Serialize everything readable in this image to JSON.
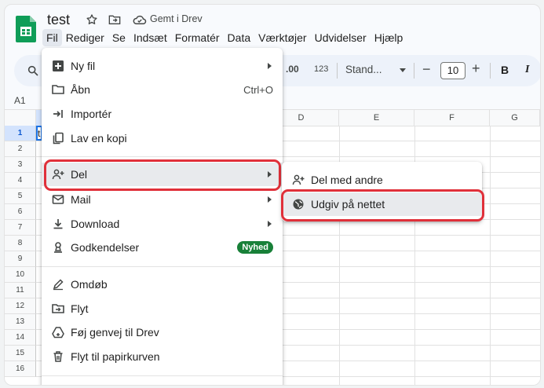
{
  "header": {
    "doc_title": "test",
    "saved_status": "Gemt i Drev"
  },
  "menubar": [
    "Fil",
    "Rediger",
    "Se",
    "Indsæt",
    "Formatér",
    "Data",
    "Værktøjer",
    "Udvidelser",
    "Hjælp"
  ],
  "toolbar": {
    "decimal_label": ".00",
    "format_label": "123",
    "font_label": "Stand...",
    "font_size": "10",
    "minus": "−",
    "plus": "+",
    "bold": "B",
    "italic": "I"
  },
  "namebox": "A1",
  "grid": {
    "columns": [
      "D",
      "E",
      "F",
      "G"
    ],
    "rows": [
      "1",
      "2",
      "3",
      "4",
      "5",
      "6",
      "7",
      "8",
      "9",
      "10",
      "11",
      "12",
      "13",
      "14",
      "15",
      "16"
    ],
    "cell_a1": "t"
  },
  "file_menu": {
    "items": [
      {
        "label": "Ny fil",
        "icon": "new-sheet-icon",
        "submenu": true
      },
      {
        "label": "Åbn",
        "icon": "folder-icon",
        "shortcut": "Ctrl+O"
      },
      {
        "label": "Importér",
        "icon": "import-icon"
      },
      {
        "label": "Lav en kopi",
        "icon": "copy-icon"
      },
      {
        "label": "Del",
        "icon": "share-person-icon",
        "submenu": true
      },
      {
        "label": "Mail",
        "icon": "mail-icon",
        "submenu": true
      },
      {
        "label": "Download",
        "icon": "download-icon",
        "submenu": true
      },
      {
        "label": "Godkendelser",
        "icon": "approvals-icon",
        "badge": "Nyhed"
      },
      {
        "label": "Omdøb",
        "icon": "rename-icon"
      },
      {
        "label": "Flyt",
        "icon": "move-folder-icon"
      },
      {
        "label": "Føj genvej til Drev",
        "icon": "drive-shortcut-icon"
      },
      {
        "label": "Flyt til papirkurven",
        "icon": "trash-icon"
      }
    ]
  },
  "share_menu": {
    "items": [
      {
        "label": "Del med andre",
        "icon": "share-person-icon"
      },
      {
        "label": "Udgiv på nettet",
        "icon": "globe-icon"
      }
    ]
  },
  "colors": {
    "highlight": "#e0303a",
    "sheets_green": "#0f9d58",
    "badge_green": "#188038"
  }
}
